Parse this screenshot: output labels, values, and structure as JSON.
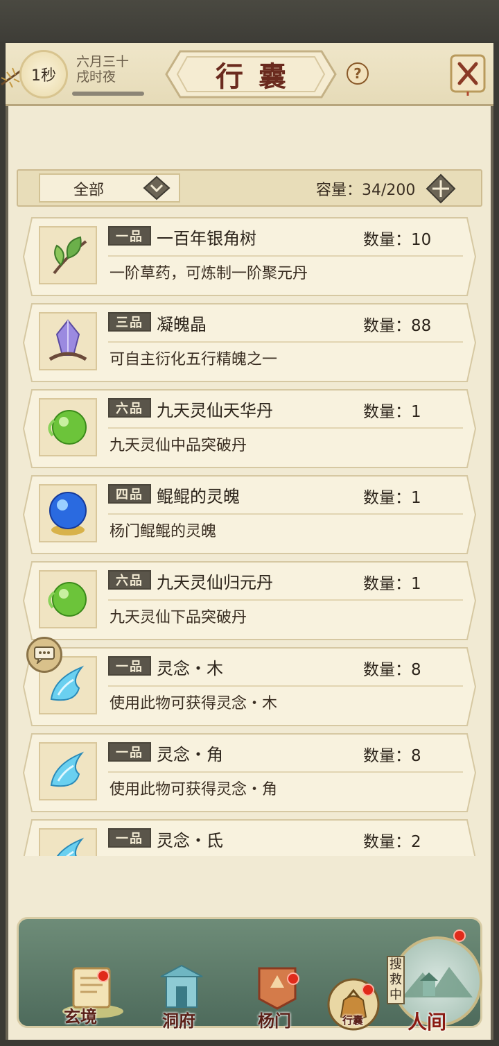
{
  "header": {
    "timer": "1秒",
    "date_line1": "六月三十",
    "date_line2": "戌时夜",
    "title": "行囊",
    "help": "?"
  },
  "filter": {
    "selected": "全部",
    "capacity": "容量：34/200"
  },
  "items": [
    {
      "grade": "一品",
      "name": "一百年银角树",
      "qty": "数量：10",
      "desc": "一阶草药，可炼制一阶聚元丹",
      "icon": "herb-leaf-icon"
    },
    {
      "grade": "三品",
      "name": "凝魄晶",
      "qty": "数量：88",
      "desc": "可自主衍化五行精魄之一",
      "icon": "crystal-icon"
    },
    {
      "grade": "六品",
      "name": "九天灵仙天华丹",
      "qty": "数量：1",
      "desc": "九天灵仙中品突破丹",
      "icon": "green-pill-icon"
    },
    {
      "grade": "四品",
      "name": "鲲鲲的灵魄",
      "qty": "数量：1",
      "desc": "杨门鲲鲲的灵魄",
      "icon": "blue-orb-icon"
    },
    {
      "grade": "六品",
      "name": "九天灵仙归元丹",
      "qty": "数量：1",
      "desc": "九天灵仙下品突破丹",
      "icon": "green-pill-icon"
    },
    {
      "grade": "一品",
      "name": "灵念・木",
      "qty": "数量：8",
      "desc": "使用此物可获得灵念・木",
      "icon": "blue-flame-icon"
    },
    {
      "grade": "一品",
      "name": "灵念・角",
      "qty": "数量：8",
      "desc": "使用此物可获得灵念・角",
      "icon": "blue-flame-icon"
    },
    {
      "grade": "一品",
      "name": "灵念・氐",
      "qty": "数量：2",
      "desc": "",
      "icon": "blue-flame-icon"
    }
  ],
  "nav": {
    "xuanjing": "玄境",
    "dongfu": "洞府",
    "yangmen": "杨门",
    "xingnang": "行囊",
    "renjian": "人间",
    "search_tag": "搜救中"
  },
  "colors": {
    "panel": "#f1ead3",
    "title": "#6a2a1e",
    "nav_green": "#5e7c6a",
    "badge_red": "#e02a1a"
  }
}
